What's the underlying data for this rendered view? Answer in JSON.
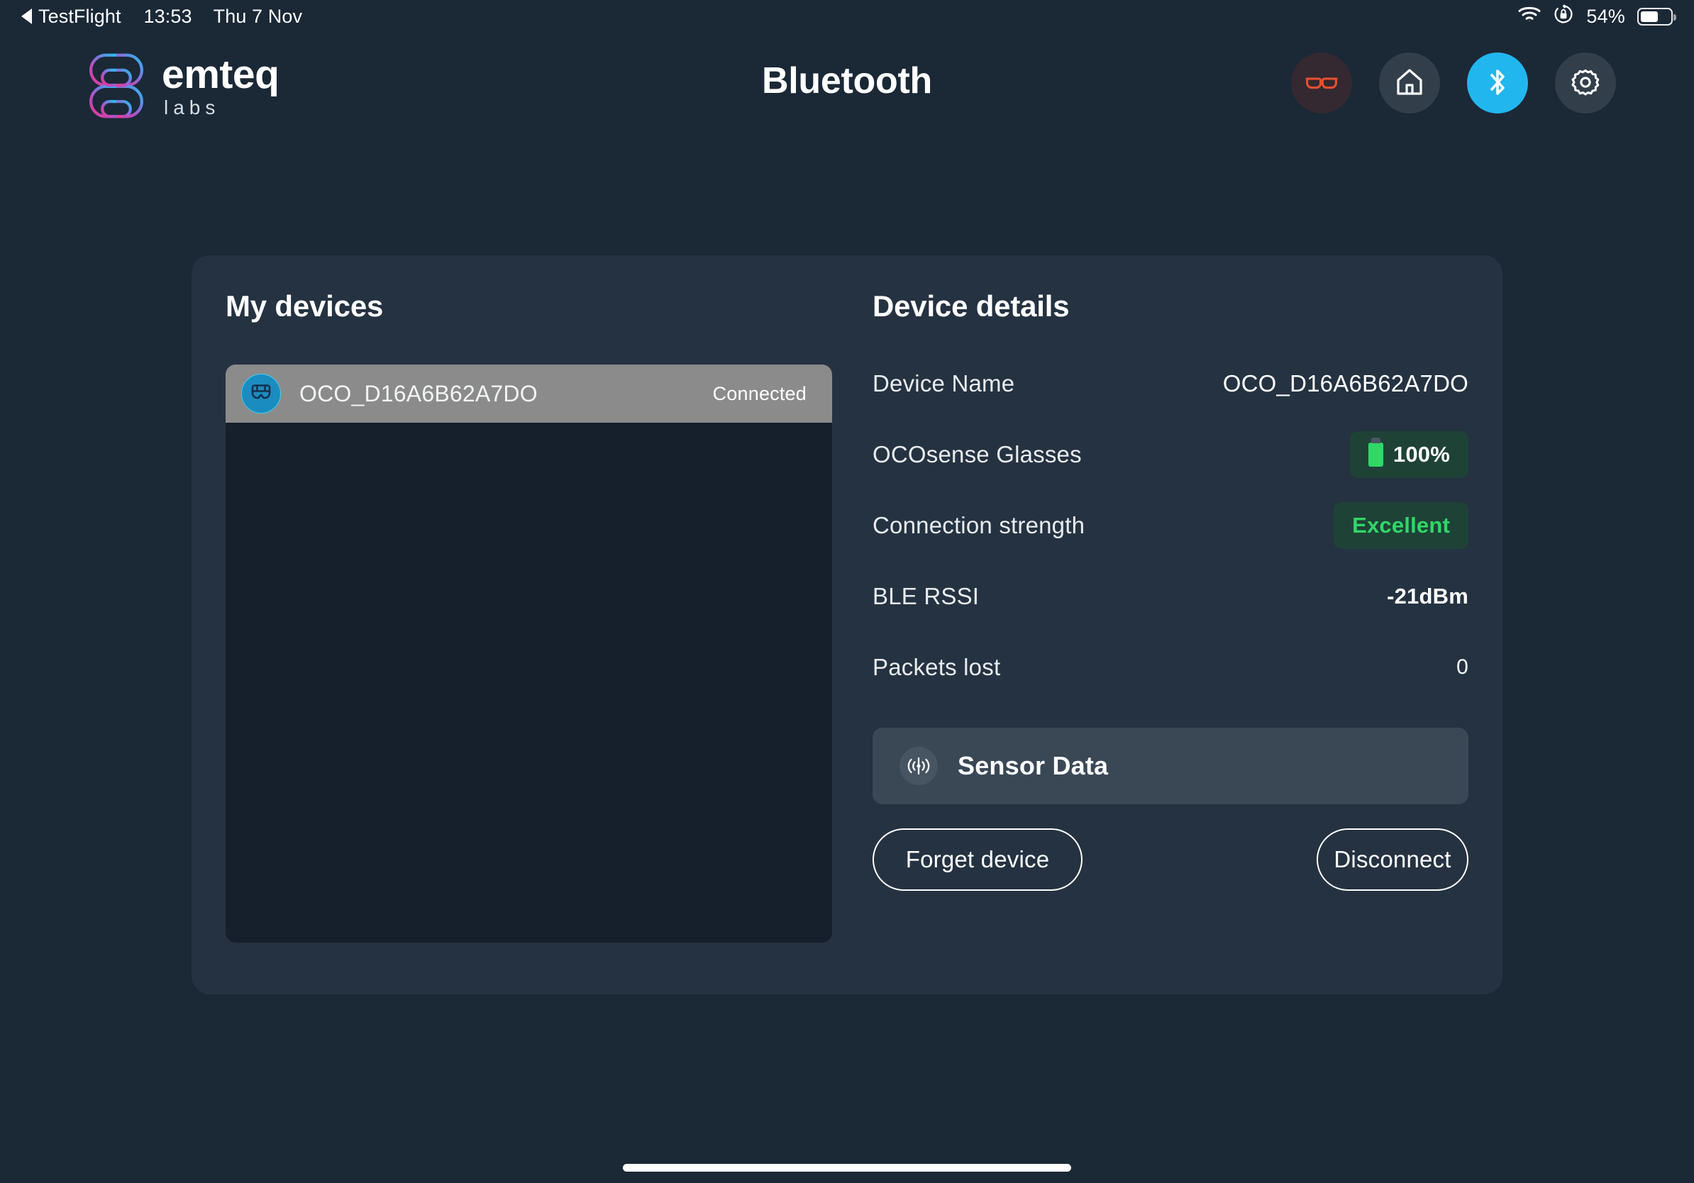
{
  "status_bar": {
    "back_label": "TestFlight",
    "back_icon": "triangle-left-icon",
    "time": "13:53",
    "date": "Thu 7 Nov",
    "wifi_icon": "wifi-icon",
    "rotation_lock_icon": "rotation-lock-icon",
    "battery_percent": "54%",
    "battery_icon": "battery-icon"
  },
  "header": {
    "logo_name": "emteq",
    "logo_sub": "labs",
    "logo_icon": "emteq-brain-logo-icon",
    "title": "Bluetooth",
    "actions": [
      {
        "name": "glasses-icon",
        "label": "Glasses",
        "state": "inactive"
      },
      {
        "name": "home-icon",
        "label": "Home",
        "state": "inactive"
      },
      {
        "name": "bluetooth-icon",
        "label": "Bluetooth",
        "state": "active"
      },
      {
        "name": "gear-icon",
        "label": "Settings",
        "state": "inactive"
      }
    ]
  },
  "devices_panel": {
    "title": "My devices",
    "items": [
      {
        "name": "OCO_D16A6B62A7DO",
        "status": "Connected",
        "icon": "glasses-avatar-icon",
        "selected": true
      }
    ]
  },
  "details_panel": {
    "title": "Device details",
    "rows": [
      {
        "label": "Device Name",
        "value": "OCO_D16A6B62A7DO",
        "type": "text"
      },
      {
        "label": "OCOsense Glasses",
        "value": "100%",
        "type": "badge-battery"
      },
      {
        "label": "Connection strength",
        "value": "Excellent",
        "type": "badge-green"
      },
      {
        "label": "BLE RSSI",
        "value": "-21dBm",
        "type": "bold"
      },
      {
        "label": "Packets lost",
        "value": "0",
        "type": "plain"
      }
    ],
    "sensor_button": {
      "label": "Sensor Data",
      "icon": "broadcast-signal-icon"
    },
    "forget_button": "Forget device",
    "disconnect_button": "Disconnect"
  },
  "colors": {
    "background": "#1b2836",
    "card": "#253241",
    "list_background": "#161f2c",
    "selected_row": "#8b8b8b",
    "accent_bluetooth": "#22b6ee",
    "accent_green": "#2fd867",
    "badge_green_bg": "#1f4237",
    "glasses_red": "#e8502f",
    "icon_circle": "#333e4b",
    "sensor_bar": "#3a4856"
  }
}
